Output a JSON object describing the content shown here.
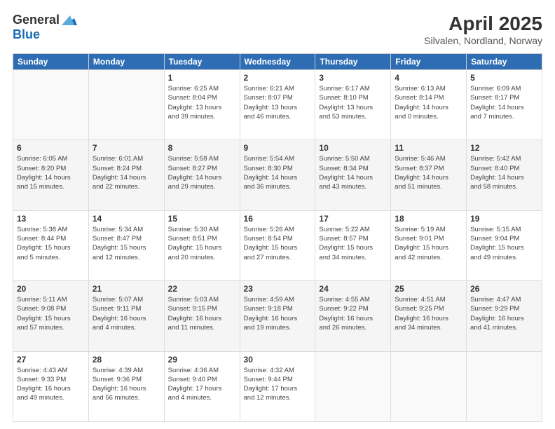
{
  "header": {
    "logo_general": "General",
    "logo_blue": "Blue",
    "title": "April 2025",
    "subtitle": "Silvalen, Nordland, Norway"
  },
  "days_of_week": [
    "Sunday",
    "Monday",
    "Tuesday",
    "Wednesday",
    "Thursday",
    "Friday",
    "Saturday"
  ],
  "weeks": [
    [
      {
        "day": "",
        "info": ""
      },
      {
        "day": "",
        "info": ""
      },
      {
        "day": "1",
        "info": "Sunrise: 6:25 AM\nSunset: 8:04 PM\nDaylight: 13 hours\nand 39 minutes."
      },
      {
        "day": "2",
        "info": "Sunrise: 6:21 AM\nSunset: 8:07 PM\nDaylight: 13 hours\nand 46 minutes."
      },
      {
        "day": "3",
        "info": "Sunrise: 6:17 AM\nSunset: 8:10 PM\nDaylight: 13 hours\nand 53 minutes."
      },
      {
        "day": "4",
        "info": "Sunrise: 6:13 AM\nSunset: 8:14 PM\nDaylight: 14 hours\nand 0 minutes."
      },
      {
        "day": "5",
        "info": "Sunrise: 6:09 AM\nSunset: 8:17 PM\nDaylight: 14 hours\nand 7 minutes."
      }
    ],
    [
      {
        "day": "6",
        "info": "Sunrise: 6:05 AM\nSunset: 8:20 PM\nDaylight: 14 hours\nand 15 minutes."
      },
      {
        "day": "7",
        "info": "Sunrise: 6:01 AM\nSunset: 8:24 PM\nDaylight: 14 hours\nand 22 minutes."
      },
      {
        "day": "8",
        "info": "Sunrise: 5:58 AM\nSunset: 8:27 PM\nDaylight: 14 hours\nand 29 minutes."
      },
      {
        "day": "9",
        "info": "Sunrise: 5:54 AM\nSunset: 8:30 PM\nDaylight: 14 hours\nand 36 minutes."
      },
      {
        "day": "10",
        "info": "Sunrise: 5:50 AM\nSunset: 8:34 PM\nDaylight: 14 hours\nand 43 minutes."
      },
      {
        "day": "11",
        "info": "Sunrise: 5:46 AM\nSunset: 8:37 PM\nDaylight: 14 hours\nand 51 minutes."
      },
      {
        "day": "12",
        "info": "Sunrise: 5:42 AM\nSunset: 8:40 PM\nDaylight: 14 hours\nand 58 minutes."
      }
    ],
    [
      {
        "day": "13",
        "info": "Sunrise: 5:38 AM\nSunset: 8:44 PM\nDaylight: 15 hours\nand 5 minutes."
      },
      {
        "day": "14",
        "info": "Sunrise: 5:34 AM\nSunset: 8:47 PM\nDaylight: 15 hours\nand 12 minutes."
      },
      {
        "day": "15",
        "info": "Sunrise: 5:30 AM\nSunset: 8:51 PM\nDaylight: 15 hours\nand 20 minutes."
      },
      {
        "day": "16",
        "info": "Sunrise: 5:26 AM\nSunset: 8:54 PM\nDaylight: 15 hours\nand 27 minutes."
      },
      {
        "day": "17",
        "info": "Sunrise: 5:22 AM\nSunset: 8:57 PM\nDaylight: 15 hours\nand 34 minutes."
      },
      {
        "day": "18",
        "info": "Sunrise: 5:19 AM\nSunset: 9:01 PM\nDaylight: 15 hours\nand 42 minutes."
      },
      {
        "day": "19",
        "info": "Sunrise: 5:15 AM\nSunset: 9:04 PM\nDaylight: 15 hours\nand 49 minutes."
      }
    ],
    [
      {
        "day": "20",
        "info": "Sunrise: 5:11 AM\nSunset: 9:08 PM\nDaylight: 15 hours\nand 57 minutes."
      },
      {
        "day": "21",
        "info": "Sunrise: 5:07 AM\nSunset: 9:11 PM\nDaylight: 16 hours\nand 4 minutes."
      },
      {
        "day": "22",
        "info": "Sunrise: 5:03 AM\nSunset: 9:15 PM\nDaylight: 16 hours\nand 11 minutes."
      },
      {
        "day": "23",
        "info": "Sunrise: 4:59 AM\nSunset: 9:18 PM\nDaylight: 16 hours\nand 19 minutes."
      },
      {
        "day": "24",
        "info": "Sunrise: 4:55 AM\nSunset: 9:22 PM\nDaylight: 16 hours\nand 26 minutes."
      },
      {
        "day": "25",
        "info": "Sunrise: 4:51 AM\nSunset: 9:25 PM\nDaylight: 16 hours\nand 34 minutes."
      },
      {
        "day": "26",
        "info": "Sunrise: 4:47 AM\nSunset: 9:29 PM\nDaylight: 16 hours\nand 41 minutes."
      }
    ],
    [
      {
        "day": "27",
        "info": "Sunrise: 4:43 AM\nSunset: 9:33 PM\nDaylight: 16 hours\nand 49 minutes."
      },
      {
        "day": "28",
        "info": "Sunrise: 4:39 AM\nSunset: 9:36 PM\nDaylight: 16 hours\nand 56 minutes."
      },
      {
        "day": "29",
        "info": "Sunrise: 4:36 AM\nSunset: 9:40 PM\nDaylight: 17 hours\nand 4 minutes."
      },
      {
        "day": "30",
        "info": "Sunrise: 4:32 AM\nSunset: 9:44 PM\nDaylight: 17 hours\nand 12 minutes."
      },
      {
        "day": "",
        "info": ""
      },
      {
        "day": "",
        "info": ""
      },
      {
        "day": "",
        "info": ""
      }
    ]
  ]
}
